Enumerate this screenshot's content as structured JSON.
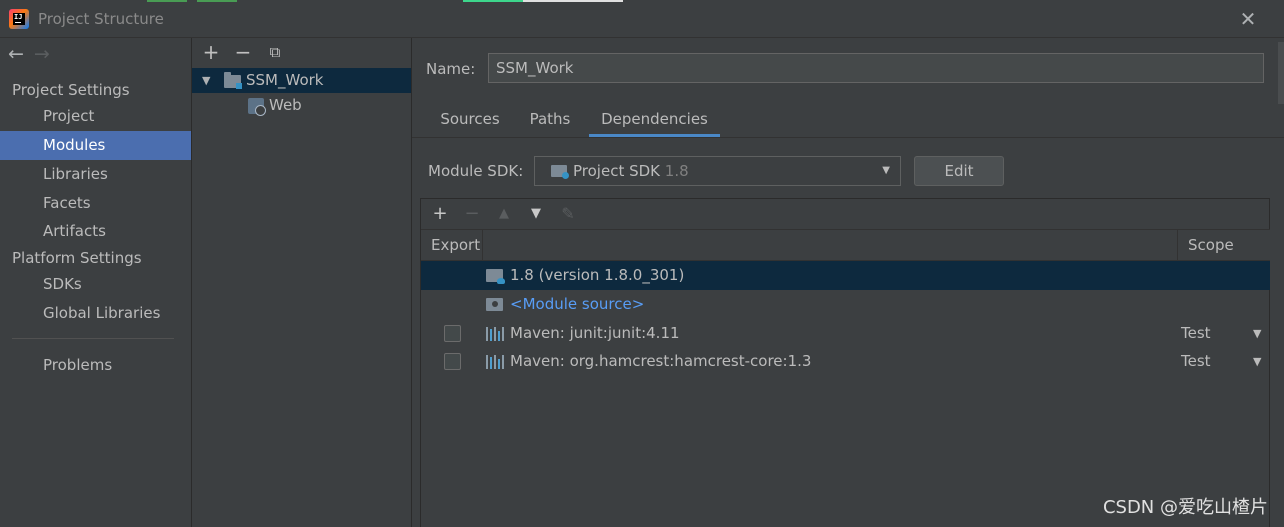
{
  "window": {
    "title": "Project Structure",
    "close_label": "✕"
  },
  "colors": {
    "selection": "#4b6eaf",
    "tree_selection": "#0d293e",
    "link": "#589df6",
    "active_tab": "#4a88c7"
  },
  "nav": {
    "back_label": "←",
    "forward_label": "→"
  },
  "sidebar": {
    "project_settings_label": "Project Settings",
    "platform_settings_label": "Platform Settings",
    "items": [
      {
        "label": "Project"
      },
      {
        "label": "Modules",
        "selected": true
      },
      {
        "label": "Libraries"
      },
      {
        "label": "Facets"
      },
      {
        "label": "Artifacts"
      },
      {
        "label": "SDKs"
      },
      {
        "label": "Global Libraries"
      },
      {
        "label": "Problems"
      }
    ]
  },
  "tree_toolbar": {
    "add_label": "+",
    "remove_label": "−",
    "copy_label": "⧉"
  },
  "tree": {
    "module": "SSM_Work",
    "facet": "Web"
  },
  "module_detail": {
    "name_label": "Name:",
    "name_value": "SSM_Work",
    "tabs": [
      {
        "label": "Sources"
      },
      {
        "label": "Paths"
      },
      {
        "label": "Dependencies",
        "active": true
      }
    ],
    "sdk_label": "Module SDK:",
    "sdk_value": "Project SDK",
    "sdk_version": "1.8",
    "edit_label": "Edit"
  },
  "dependencies": {
    "toolbar": {
      "add_label": "+",
      "remove_label": "−",
      "up_label": "▲",
      "down_label": "▼",
      "edit_label": "✎"
    },
    "header": {
      "export_label": "Export",
      "scope_label": "Scope"
    },
    "rows": [
      {
        "name": "1.8 (version 1.8.0_301)",
        "icon": "jdk-folder-icon",
        "selected": true
      },
      {
        "name": "<Module source>",
        "icon": "module-source-icon"
      },
      {
        "name": "Maven: junit:junit:4.11",
        "icon": "maven-library-icon",
        "scope": "Test"
      },
      {
        "name": "Maven: org.hamcrest:hamcrest-core:1.3",
        "icon": "maven-library-icon",
        "scope": "Test"
      }
    ]
  },
  "watermark": "CSDN @爱吃山楂片"
}
